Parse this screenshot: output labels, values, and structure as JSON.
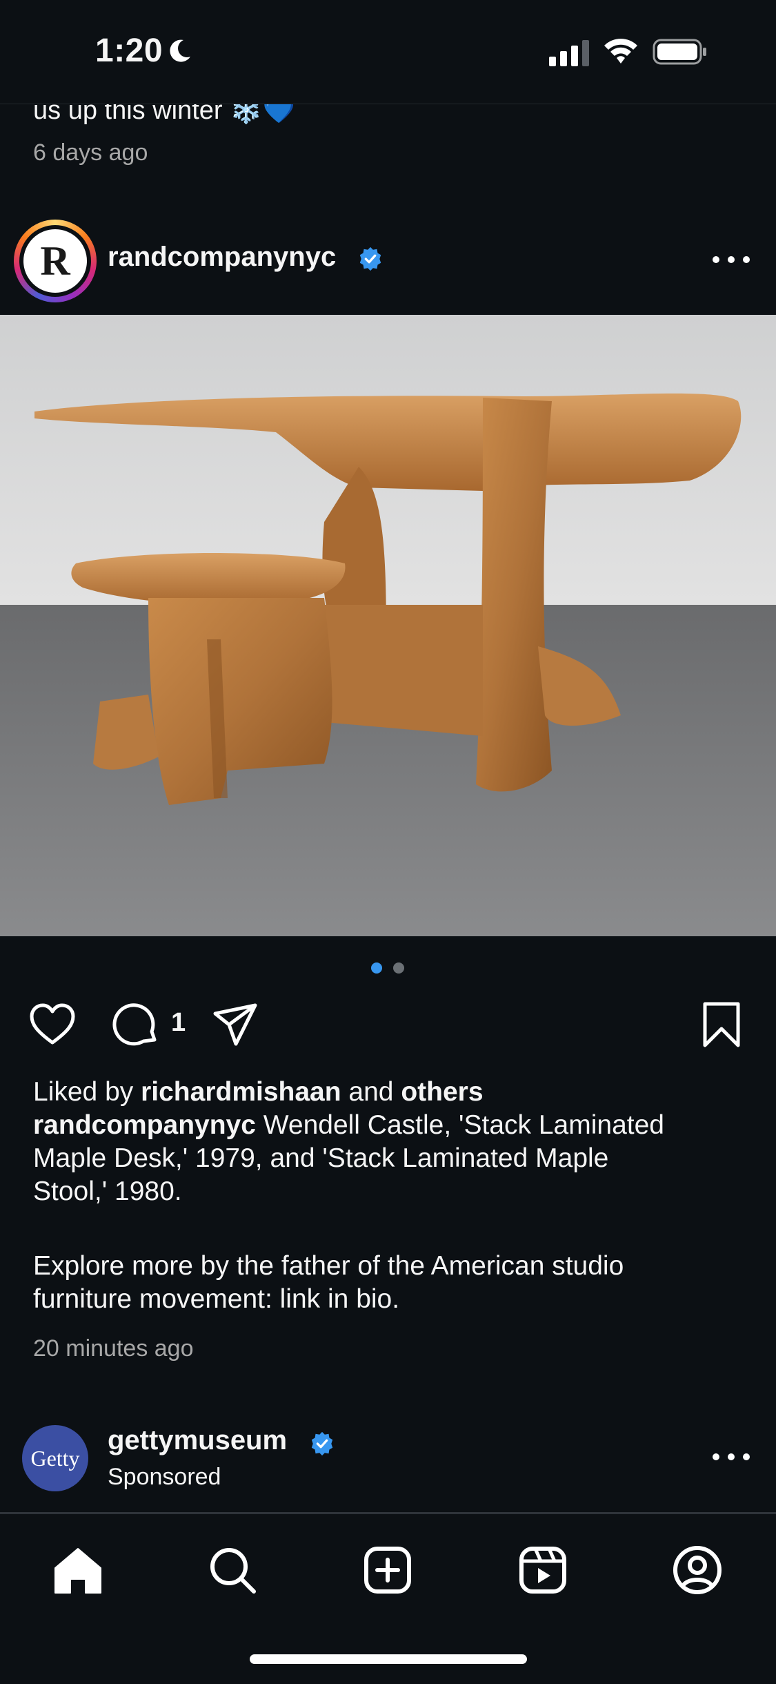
{
  "status_bar": {
    "time": "1:20"
  },
  "previous_post": {
    "caption_fragment": "us up this winter ❄️💙",
    "timestamp": "6 days ago"
  },
  "post": {
    "username": "randcompanynyc",
    "avatar_letter": "R",
    "carousel": {
      "count": 2,
      "active": 1
    },
    "comment_count": "1",
    "liked_by_prefix": "Liked by",
    "liked_by_user": "richardmishaan",
    "liked_by_and": "and",
    "liked_by_others": "others",
    "caption_user": "randcompanynyc",
    "caption_text_1": "Wendell Castle, 'Stack Laminated",
    "caption_text_2": "Maple Desk,' 1979, and 'Stack Laminated Maple",
    "caption_text_3": "Stool,' 1980.",
    "caption_text_4": "Explore more by the father of the American studio",
    "caption_text_5": "furniture movement: link in bio.",
    "timestamp": "20 minutes ago"
  },
  "next_post": {
    "username": "gettymuseum",
    "avatar_text": "Getty",
    "subtitle": "Sponsored"
  },
  "colors": {
    "verified": "#3897f0",
    "carousel_active": "#3897f0",
    "background": "#0c1014"
  },
  "tab_bar": [
    "home-icon",
    "search-icon",
    "create-icon",
    "reels-icon",
    "profile-icon"
  ]
}
